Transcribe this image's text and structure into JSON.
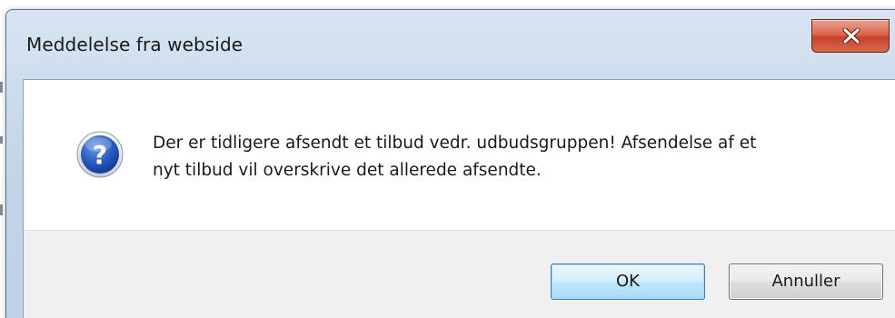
{
  "dialog": {
    "title": "Meddelelse fra webside",
    "close_icon": "close-icon",
    "message_icon": "question-icon",
    "message_line_1": "Der er tidligere afsendt et tilbud vedr. udbudsgruppen! Afsendelse af et",
    "message_line_2": "nyt tilbud vil overskrive det allerede afsendte.",
    "ok_label": "OK",
    "cancel_label": "Annuller"
  },
  "colors": {
    "titlebar": "#c4d5e8",
    "close_button": "#c7432a",
    "ok_border": "#3c7fb1",
    "button_strip": "#f0f0f0"
  }
}
